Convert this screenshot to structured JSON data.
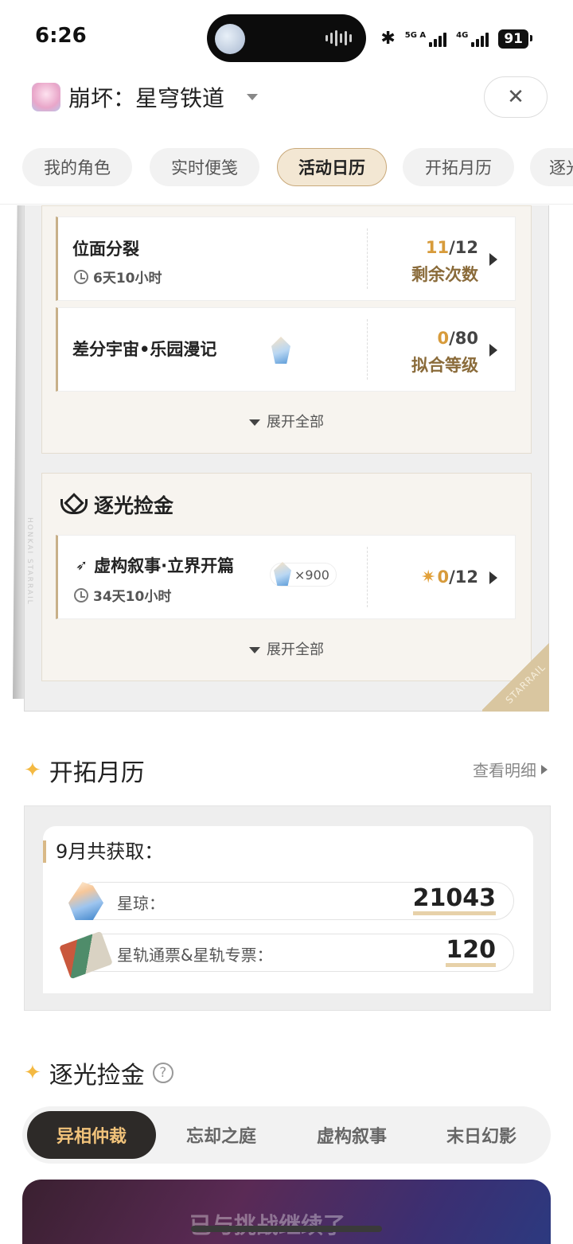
{
  "status_bar": {
    "time": "6:26",
    "signal_1": "5G A",
    "signal_2": "4G",
    "battery": "91"
  },
  "header": {
    "game_title": "崩坏：星穹铁道",
    "game_icon": "game-avatar-icon",
    "close_icon": "close-icon"
  },
  "tabs": [
    {
      "label": "我的角色",
      "active": false
    },
    {
      "label": "实时便笺",
      "active": false
    },
    {
      "label": "活动日历",
      "active": true
    },
    {
      "label": "开拓月历",
      "active": false
    },
    {
      "label": "逐光",
      "active": false
    }
  ],
  "activity_calendar": {
    "rows": [
      {
        "title": "位面分裂",
        "time": "6天10小时",
        "current": "11",
        "total": "/12",
        "label": "剩余次数"
      },
      {
        "title": "差分宇宙•乐园漫记",
        "current": "0",
        "total": "/80",
        "label": "拟合等级"
      }
    ],
    "expand_label": "展开全部",
    "section2": {
      "title": "逐光捡金",
      "rows": [
        {
          "title": "虚构叙事·立界开篇",
          "time": "34天10小时",
          "reward": "×900",
          "current": "0",
          "total": "/12"
        }
      ],
      "expand_label": "展开全部"
    },
    "frame_brand": "STARRAIL",
    "frame_side_text": "HONKAI STARRAIL"
  },
  "monthly": {
    "title": "开拓月历",
    "view_detail": "查看明细",
    "month_label": "9月共获取：",
    "items": [
      {
        "label": "星琼：",
        "value": "21043"
      },
      {
        "label": "星轨通票&星轨专票：",
        "value": "120"
      }
    ]
  },
  "endgame": {
    "title": "逐光捡金",
    "help": "?",
    "segments": [
      {
        "label": "异相仲裁",
        "active": true
      },
      {
        "label": "忘却之庭",
        "active": false
      },
      {
        "label": "虚构叙事",
        "active": false
      },
      {
        "label": "末日幻影",
        "active": false
      }
    ],
    "banner_text": "已与挑战继续了"
  },
  "colors": {
    "accent_gold": "#d79b3b",
    "tab_active_bg": "#f3e7d3",
    "segment_active_bg": "#2d2a28",
    "segment_active_text": "#f0c27a"
  }
}
